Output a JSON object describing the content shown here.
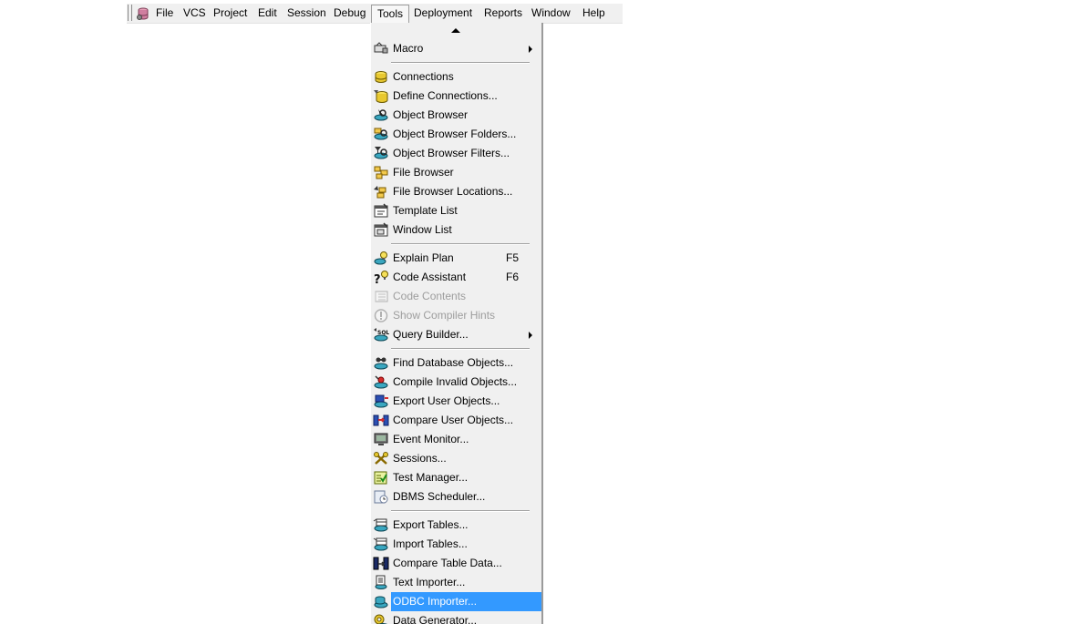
{
  "menubar": {
    "items": [
      "File",
      "VCS",
      "Project",
      "Edit",
      "Session",
      "Debug",
      "Tools",
      "Deployment",
      "Reports",
      "Window",
      "Help"
    ],
    "active": "Tools"
  },
  "tools_menu": {
    "items": [
      {
        "label": "Macro",
        "icon": "macro-icon",
        "submenu": true
      },
      {
        "label": "Connections",
        "icon": "connections-icon"
      },
      {
        "label": "Define Connections...",
        "icon": "define-connections-icon"
      },
      {
        "label": "Object Browser",
        "icon": "object-browser-icon"
      },
      {
        "label": "Object Browser Folders...",
        "icon": "object-browser-folders-icon"
      },
      {
        "label": "Object Browser Filters...",
        "icon": "object-browser-filters-icon"
      },
      {
        "label": "File Browser",
        "icon": "file-browser-icon"
      },
      {
        "label": "File Browser Locations...",
        "icon": "file-browser-locations-icon"
      },
      {
        "label": "Template List",
        "icon": "template-list-icon"
      },
      {
        "label": "Window List",
        "icon": "window-list-icon"
      },
      {
        "label": "Explain Plan",
        "icon": "explain-plan-icon",
        "shortcut": "F5"
      },
      {
        "label": "Code Assistant",
        "icon": "code-assistant-icon",
        "shortcut": "F6"
      },
      {
        "label": "Code Contents",
        "icon": "code-contents-icon",
        "disabled": true
      },
      {
        "label": "Show Compiler Hints",
        "icon": "compiler-hints-icon",
        "disabled": true
      },
      {
        "label": "Query Builder...",
        "icon": "query-builder-icon",
        "submenu": true
      },
      {
        "label": "Find Database Objects...",
        "icon": "find-objects-icon"
      },
      {
        "label": "Compile Invalid Objects...",
        "icon": "compile-invalid-icon"
      },
      {
        "label": "Export User Objects...",
        "icon": "export-user-objects-icon"
      },
      {
        "label": "Compare User Objects...",
        "icon": "compare-user-objects-icon"
      },
      {
        "label": "Event Monitor...",
        "icon": "event-monitor-icon"
      },
      {
        "label": "Sessions...",
        "icon": "sessions-icon"
      },
      {
        "label": "Test Manager...",
        "icon": "test-manager-icon"
      },
      {
        "label": "DBMS Scheduler...",
        "icon": "dbms-scheduler-icon"
      },
      {
        "label": "Export Tables...",
        "icon": "export-tables-icon"
      },
      {
        "label": "Import Tables...",
        "icon": "import-tables-icon"
      },
      {
        "label": "Compare Table Data...",
        "icon": "compare-table-data-icon"
      },
      {
        "label": "Text Importer...",
        "icon": "text-importer-icon"
      },
      {
        "label": "ODBC Importer...",
        "icon": "odbc-importer-icon",
        "selected": true
      },
      {
        "label": "Data Generator...",
        "icon": "data-generator-icon"
      }
    ]
  },
  "colors": {
    "selection": "#3399ff",
    "menu_bg": "#f0f0f0",
    "disabled_text": "#9d9d9d"
  }
}
